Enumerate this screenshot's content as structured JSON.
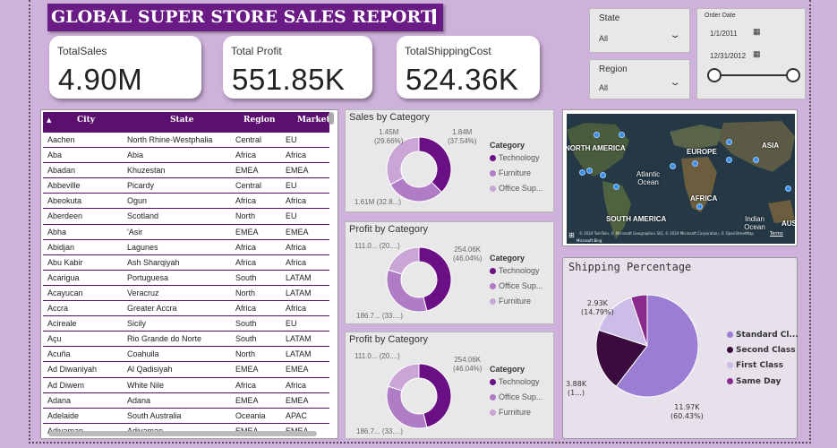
{
  "report_title": "GLOBAL SUPER STORE SALES REPORT",
  "kpis": [
    {
      "label": "TotalSales",
      "value": "4.90M"
    },
    {
      "label": "Total Profit",
      "value": "551.85K"
    },
    {
      "label": "TotalShippingCost",
      "value": "524.36K"
    }
  ],
  "slicers": {
    "state": {
      "label": "State",
      "value": "All"
    },
    "region": {
      "label": "Region",
      "value": "All"
    },
    "order_date": {
      "label": "Order Date",
      "start": "1/1/2011",
      "end": "12/31/2012"
    }
  },
  "table": {
    "columns": [
      "City",
      "State",
      "Region",
      "Market"
    ],
    "rows": [
      [
        "Aachen",
        "North Rhine-Westphalia",
        "Central",
        "EU"
      ],
      [
        "Aba",
        "Abia",
        "Africa",
        "Africa"
      ],
      [
        "Abadan",
        "Khuzestan",
        "EMEA",
        "EMEA"
      ],
      [
        "Abbeville",
        "Picardy",
        "Central",
        "EU"
      ],
      [
        "Abeokuta",
        "Ogun",
        "Africa",
        "Africa"
      ],
      [
        "Aberdeen",
        "Scotland",
        "North",
        "EU"
      ],
      [
        "Abha",
        "'Asir",
        "EMEA",
        "EMEA"
      ],
      [
        "Abidjan",
        "Lagunes",
        "Africa",
        "Africa"
      ],
      [
        "Abu Kabir",
        "Ash Sharqiyah",
        "Africa",
        "Africa"
      ],
      [
        "Acarigua",
        "Portuguesa",
        "South",
        "LATAM"
      ],
      [
        "Acayucan",
        "Veracruz",
        "North",
        "LATAM"
      ],
      [
        "Accra",
        "Greater Accra",
        "Africa",
        "Africa"
      ],
      [
        "Acireale",
        "Sicily",
        "South",
        "EU"
      ],
      [
        "Açu",
        "Rio Grande do Norte",
        "South",
        "LATAM"
      ],
      [
        "Acuña",
        "Coahuila",
        "North",
        "LATAM"
      ],
      [
        "Ad Diwaniyah",
        "Al Qadisiyah",
        "EMEA",
        "EMEA"
      ],
      [
        "Ad Diwem",
        "White Nile",
        "Africa",
        "Africa"
      ],
      [
        "Adana",
        "Adana",
        "EMEA",
        "EMEA"
      ],
      [
        "Adelaide",
        "South Australia",
        "Oceania",
        "APAC"
      ],
      [
        "Adiyaman",
        "Adiyaman",
        "EMEA",
        "EMEA"
      ]
    ]
  },
  "colors": {
    "technology": "#6a0f84",
    "furniture": "#b07cc6",
    "office_supplies": "#c9a6d6",
    "standard_class": "#9b7dd4",
    "second_class": "#3b0a3f",
    "first_class": "#cdbce8",
    "same_day": "#8a2a8c"
  },
  "charts": {
    "sales": {
      "title": "Sales by Category",
      "legend_title": "Category",
      "legend": [
        "Technology",
        "Furniture",
        "Office Sup..."
      ],
      "labels": [
        {
          "line1": "1.84M",
          "line2": "(37.54%)"
        },
        {
          "line1": "1.45M",
          "line2": "(29.66%)"
        },
        {
          "line1": "1.61M (32.8...)",
          "line2": ""
        }
      ]
    },
    "profit1": {
      "title": "Profit by Category",
      "legend_title": "Category",
      "legend": [
        "Technology",
        "Office Sup...",
        "Furniture"
      ],
      "labels": [
        {
          "line1": "254.06K",
          "line2": "(46.04%)"
        },
        {
          "line1": "111.0... (20....)",
          "line2": ""
        },
        {
          "line1": "186.7... (33....)",
          "line2": ""
        }
      ]
    },
    "profit2": {
      "title": "Profit by Category",
      "legend_title": "Category",
      "legend": [
        "Technology",
        "Office Sup...",
        "Furniture"
      ],
      "labels": [
        {
          "line1": "254.06K",
          "line2": "(46.04%)"
        },
        {
          "line1": "111.0... (20....)",
          "line2": ""
        },
        {
          "line1": "186.7... (33....)",
          "line2": ""
        }
      ]
    },
    "shipping": {
      "title": "Shipping Percentage",
      "legend": [
        "Standard Cl...",
        "Second Class",
        "First Class",
        "Same Day"
      ],
      "labels": [
        {
          "line1": "2.93K",
          "line2": "(14.79%)"
        },
        {
          "line1": "3.88K",
          "line2": "(1...)"
        },
        {
          "line1": "11.97K",
          "line2": "(60.43%)"
        }
      ]
    }
  },
  "chart_data": [
    {
      "type": "pie",
      "title": "Sales by Category",
      "categories": [
        "Technology",
        "Furniture",
        "Office Supplies"
      ],
      "values": [
        1.84,
        1.45,
        1.61
      ],
      "percent": [
        37.54,
        29.66,
        32.8
      ]
    },
    {
      "type": "pie",
      "title": "Profit by Category",
      "categories": [
        "Technology",
        "Office Supplies",
        "Furniture"
      ],
      "values": [
        254.06,
        186.7,
        111.0
      ],
      "percent": [
        46.04,
        33.8,
        20.1
      ]
    },
    {
      "type": "pie",
      "title": "Profit by Category",
      "categories": [
        "Technology",
        "Office Supplies",
        "Furniture"
      ],
      "values": [
        254.06,
        186.7,
        111.0
      ],
      "percent": [
        46.04,
        33.8,
        20.1
      ]
    },
    {
      "type": "pie",
      "title": "Shipping Percentage",
      "categories": [
        "Standard Class",
        "Second Class",
        "First Class",
        "Same Day"
      ],
      "values": [
        11.97,
        3.88,
        2.93,
        1.03
      ],
      "percent": [
        60.43,
        19.58,
        14.79,
        5.2
      ]
    }
  ],
  "map": {
    "labels": [
      "NORTH AMERICA",
      "EUROPE",
      "ASIA",
      "Atlantic Ocean",
      "AFRICA",
      "SOUTH AMERICA",
      "Indian Ocean",
      "AUS"
    ],
    "attribution": "© 2024 TomTom, © Microsoft Geographics SIO, © 2024 Microsoft Corporation, © OpenStreetMap",
    "terms": "Terms",
    "bing": "Microsoft Bing"
  }
}
